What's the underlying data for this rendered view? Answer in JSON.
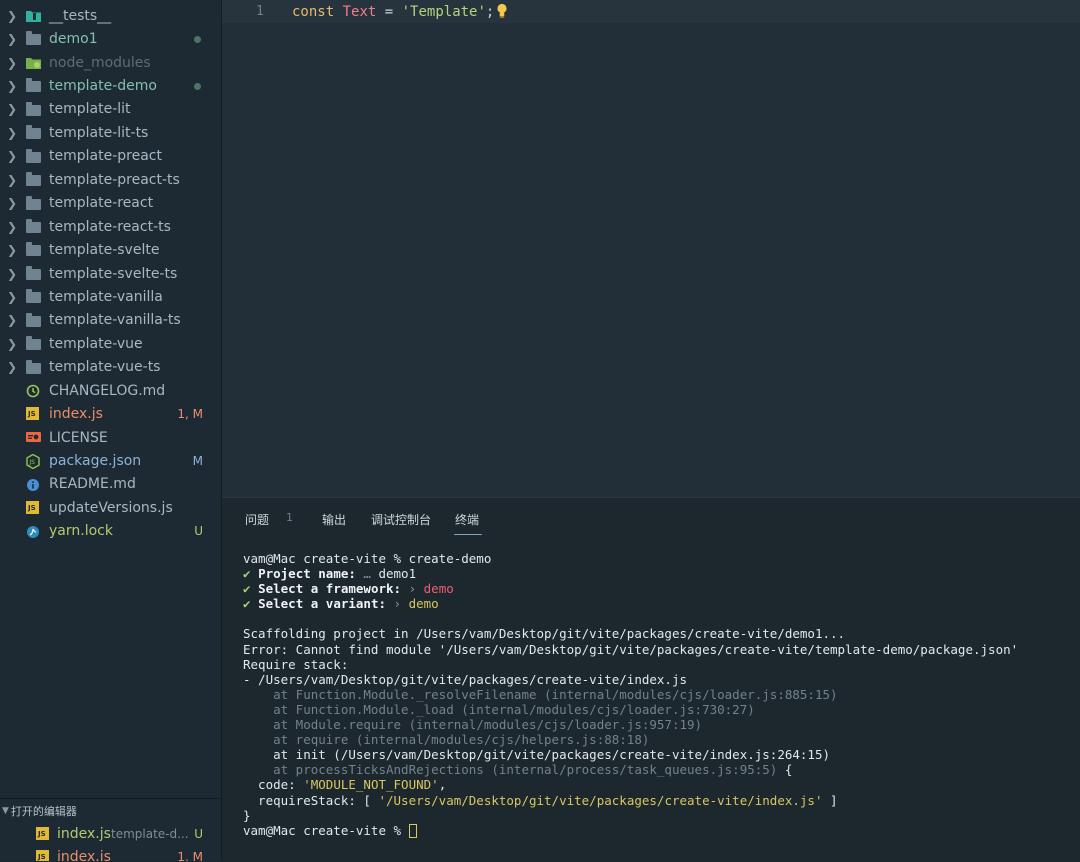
{
  "sidebar": {
    "tree": [
      {
        "label": "__tests__",
        "kind": "folder-test",
        "color": "#a8b7c3",
        "badge": "",
        "dot": false,
        "chevron": true
      },
      {
        "label": "demo1",
        "kind": "folder",
        "color": "#85c0ad",
        "badge": "",
        "dot": true,
        "chevron": true
      },
      {
        "label": "node_modules",
        "kind": "folder-node",
        "color": "#5d6c77",
        "badge": "",
        "dot": false,
        "chevron": true
      },
      {
        "label": "template-demo",
        "kind": "folder",
        "color": "#85c0ad",
        "badge": "",
        "dot": true,
        "chevron": true
      },
      {
        "label": "template-lit",
        "kind": "folder",
        "color": "#a8b7c3",
        "badge": "",
        "dot": false,
        "chevron": true
      },
      {
        "label": "template-lit-ts",
        "kind": "folder",
        "color": "#a8b7c3",
        "badge": "",
        "dot": false,
        "chevron": true
      },
      {
        "label": "template-preact",
        "kind": "folder",
        "color": "#a8b7c3",
        "badge": "",
        "dot": false,
        "chevron": true
      },
      {
        "label": "template-preact-ts",
        "kind": "folder",
        "color": "#a8b7c3",
        "badge": "",
        "dot": false,
        "chevron": true
      },
      {
        "label": "template-react",
        "kind": "folder",
        "color": "#a8b7c3",
        "badge": "",
        "dot": false,
        "chevron": true
      },
      {
        "label": "template-react-ts",
        "kind": "folder",
        "color": "#a8b7c3",
        "badge": "",
        "dot": false,
        "chevron": true
      },
      {
        "label": "template-svelte",
        "kind": "folder",
        "color": "#a8b7c3",
        "badge": "",
        "dot": false,
        "chevron": true
      },
      {
        "label": "template-svelte-ts",
        "kind": "folder",
        "color": "#a8b7c3",
        "badge": "",
        "dot": false,
        "chevron": true
      },
      {
        "label": "template-vanilla",
        "kind": "folder",
        "color": "#a8b7c3",
        "badge": "",
        "dot": false,
        "chevron": true
      },
      {
        "label": "template-vanilla-ts",
        "kind": "folder",
        "color": "#a8b7c3",
        "badge": "",
        "dot": false,
        "chevron": true
      },
      {
        "label": "template-vue",
        "kind": "folder",
        "color": "#a8b7c3",
        "badge": "",
        "dot": false,
        "chevron": true
      },
      {
        "label": "template-vue-ts",
        "kind": "folder",
        "color": "#a8b7c3",
        "badge": "",
        "dot": false,
        "chevron": true
      },
      {
        "label": "CHANGELOG.md",
        "kind": "changelog",
        "color": "#a8b7c3",
        "badge": "",
        "dot": false,
        "chevron": false
      },
      {
        "label": "index.js",
        "kind": "js",
        "color": "#e88f6c",
        "badge": "1, M",
        "badgeColor": "#e88f6c",
        "dot": false,
        "chevron": false
      },
      {
        "label": "LICENSE",
        "kind": "license",
        "color": "#a8b7c3",
        "badge": "",
        "dot": false,
        "chevron": false
      },
      {
        "label": "package.json",
        "kind": "nodejs",
        "color": "#8fb3d6",
        "badge": "M",
        "badgeColor": "#8fb3d6",
        "dot": false,
        "chevron": false
      },
      {
        "label": "README.md",
        "kind": "info",
        "color": "#a8b7c3",
        "badge": "",
        "dot": false,
        "chevron": false
      },
      {
        "label": "updateVersions.js",
        "kind": "js",
        "color": "#a8b7c3",
        "badge": "",
        "dot": false,
        "chevron": false
      },
      {
        "label": "yarn.lock",
        "kind": "yarn",
        "color": "#b6c96e",
        "badge": "U",
        "badgeColor": "#b6c96e",
        "dot": false,
        "chevron": false
      }
    ],
    "open_editors": {
      "title": "打开的编辑器",
      "items": [
        {
          "name": "index.js",
          "desc": "template-d...",
          "badge": "U",
          "color": "#b6c96e"
        },
        {
          "name": "index.js",
          "desc": "",
          "badge": "1, M",
          "color": "#e88f6c"
        }
      ]
    }
  },
  "editor": {
    "line_number": "1",
    "code": {
      "kw": "const",
      "ident": "Text",
      "op": "=",
      "str": "'Template'",
      "semi": ";"
    }
  },
  "panel": {
    "tabs": [
      {
        "label": "问题",
        "count": "1"
      },
      {
        "label": "输出",
        "count": ""
      },
      {
        "label": "调试控制台",
        "count": ""
      },
      {
        "label": "终端",
        "count": ""
      }
    ],
    "active_tab": "终端"
  },
  "terminal": {
    "prompt_cmd": "vam@Mac create-vite % create-demo",
    "q1_label": "Project name:",
    "q1_sep": " … ",
    "q1_value": "demo1",
    "q2_label": "Select a framework:",
    "q2_sep": " › ",
    "q2_value": "demo",
    "q3_label": "Select a variant:",
    "q3_sep": " › ",
    "q3_value": "demo",
    "check": "✔",
    "scaffold": "Scaffolding project in /Users/vam/Desktop/git/vite/packages/create-vite/demo1...",
    "error": "Error: Cannot find module '/Users/vam/Desktop/git/vite/packages/create-vite/template-demo/package.json'",
    "require_stack": "Require stack:",
    "stack_path": "- /Users/vam/Desktop/git/vite/packages/create-vite/index.js",
    "at1": "    at Function.Module._resolveFilename (internal/modules/cjs/loader.js:885:15)",
    "at2": "    at Function.Module._load (internal/modules/cjs/loader.js:730:27)",
    "at3": "    at Module.require (internal/modules/cjs/loader.js:957:19)",
    "at4": "    at require (internal/modules/cjs/helpers.js:88:18)",
    "at5": "    at init (/Users/vam/Desktop/git/vite/packages/create-vite/index.js:264:15)",
    "at6": "    at processTicksAndRejections (internal/process/task_queues.js:95:5)",
    "brace_open": " {",
    "code_label": "  code: ",
    "code_value": "'MODULE_NOT_FOUND'",
    "code_comma": ",",
    "rs_label": "  requireStack: [ ",
    "rs_value": "'/Users/vam/Desktop/git/vite/packages/create-vite/index.js'",
    "rs_end": " ]",
    "brace_close": "}",
    "prompt_end": "vam@Mac create-vite % "
  }
}
